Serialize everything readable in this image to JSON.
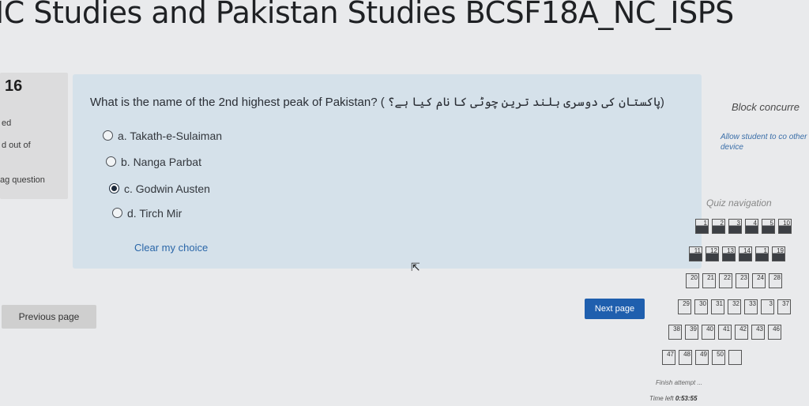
{
  "page": {
    "title": "IC Studies and Pakistan Studies BCSF18A_NC_ISPS"
  },
  "info": {
    "question_number": "16",
    "status": "ed",
    "marks": "d out of",
    "flag": "ag question"
  },
  "question": {
    "text": "What is the name of the 2nd highest peak of Pakistan? (",
    "urdu_text": "پاکستان کی دوسری بلند ترین چوٹی کا نام کیا ہے؟",
    "urdu_close": ")",
    "options": [
      {
        "label": "a. Takath-e-Sulaiman",
        "selected": false
      },
      {
        "label": "b. Nanga Parbat",
        "selected": false
      },
      {
        "label": "c. Godwin Austen",
        "selected": true
      },
      {
        "label": "d. Tirch Mir",
        "selected": false
      }
    ],
    "clear_label": "Clear my choice"
  },
  "buttons": {
    "previous": "Previous page",
    "next": "Next page"
  },
  "sidebar": {
    "block_title": "Block concurre",
    "block_link": "Allow student to co other device",
    "nav_title": "Quiz navigation",
    "nav_numbers": [
      "1",
      "2",
      "3",
      "4",
      "5",
      "10",
      "11",
      "12",
      "13",
      "14",
      "1",
      "19",
      "20",
      "21",
      "22",
      "23",
      "24",
      "28",
      "29",
      "30",
      "31",
      "32",
      "33",
      "3",
      "37",
      "38",
      "39",
      "40",
      "41",
      "42",
      "43",
      "46",
      "47",
      "48",
      "49",
      "50"
    ],
    "finish": "Finish attempt ...",
    "timer_label": "Time left",
    "timer_value": "0:53:55"
  },
  "colors": {
    "accent": "#1f5fae",
    "question_bg": "#d5e1ea",
    "link": "#2a66a8"
  }
}
